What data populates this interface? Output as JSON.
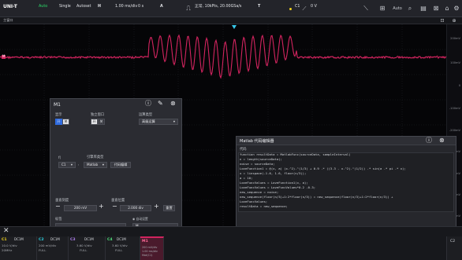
{
  "topbar": {
    "logo": "UNI-T",
    "mode_auto": "Auto",
    "single": "Single",
    "autoset": "Autoset",
    "trigger_state": "H",
    "timebase": "1.00 ms/div",
    "time_offset": "0 s",
    "acq_mode": "A",
    "sample_info": "正常, 10kPts, 20.00GSa/s",
    "trig_type": "T",
    "trig_source": "C1",
    "trig_level": "0 V",
    "main_window": "主窗口"
  },
  "scale_labels": [
    "200mV",
    "100mV",
    "0",
    "-100mV",
    "-200mV",
    "-300mV",
    "-400mV",
    "-500mV",
    "-600mV"
  ],
  "m1": {
    "title": "M1",
    "display_label": "显示",
    "display_on": "开",
    "display_off": "关",
    "window_label": "独立窗口",
    "window_on": "开",
    "window_off": "关",
    "op_type_label": "运算类型",
    "op_type_value": "高级运算",
    "expr_label": "f(",
    "expr_source": "C1",
    "expr_sep": ",",
    "expr_end": ")",
    "script_type_label": "引擎库类型",
    "script_type_value": "Matlab",
    "code_edit_btn": "代码编辑",
    "vscale_label": "垂直刻度",
    "vscale_value": "200 mV",
    "vpos_label": "垂直位置",
    "vpos_value": "2.000 div",
    "reset_btn": "重置",
    "tag_label": "标签",
    "auto_label": "自动设置",
    "tag_value": "M"
  },
  "matlab": {
    "title": "Matlab 代码编辑器",
    "code_heading": "代码",
    "code_lines": [
      "function resultData = MatlabFunc(sourceData, sampleInterval)",
      "n = length(sourceData);",
      "noise = sourceData;",
      "LoveFunction1 = @(x, a) (x.^2).^(1/3) + 0.9 .* ((3.3 - x.^2).^(1/2)) .* sin(a .* pi .* x);",
      "x = linspace(-1.6, 1.6, floor(n/3));",
      "a = 10;",
      "LoveFuncValues = LoveFunction1(x, a);",
      "LoveFuncValues = LoveFuncValues*0.2 -0.3;",
      "new_sequence = noise;",
      "new_sequence(floor(n/3)+1:2*floor(n/3)) = new_sequence(floor(n/3)+1:2*floor(n/3)) +",
      "LoveFuncValues;",
      "resultData = new_sequence;"
    ],
    "result_heading": "运行结果"
  },
  "channels": [
    {
      "name": "C1",
      "coupling": "DC1M",
      "scale": "10.0 V/div",
      "bw": "20MHz",
      "color": "#f2d31b"
    },
    {
      "name": "C2",
      "coupling": "DC1M",
      "scale": "200 mV/div",
      "bw": "FULL",
      "color": "#2bd4e6"
    },
    {
      "name": "C3",
      "coupling": "DC1M",
      "scale": "3.60 V/div",
      "bw": "FULL",
      "color": "#b07ff0"
    },
    {
      "name": "C4",
      "coupling": "DC1M",
      "scale": "3.60 V/div",
      "bw": "FULL",
      "color": "#4fe07a"
    }
  ],
  "math_tab": {
    "name": "M1",
    "scale": "200 mV/div",
    "time": "1.00 ms/div",
    "func": "Mat(C1)"
  },
  "right_bottom": {
    "label": "C2"
  },
  "colors": {
    "waveform": "#d2245f",
    "accent": "#2f6be0",
    "trigger_marker": "#37c7e8"
  }
}
